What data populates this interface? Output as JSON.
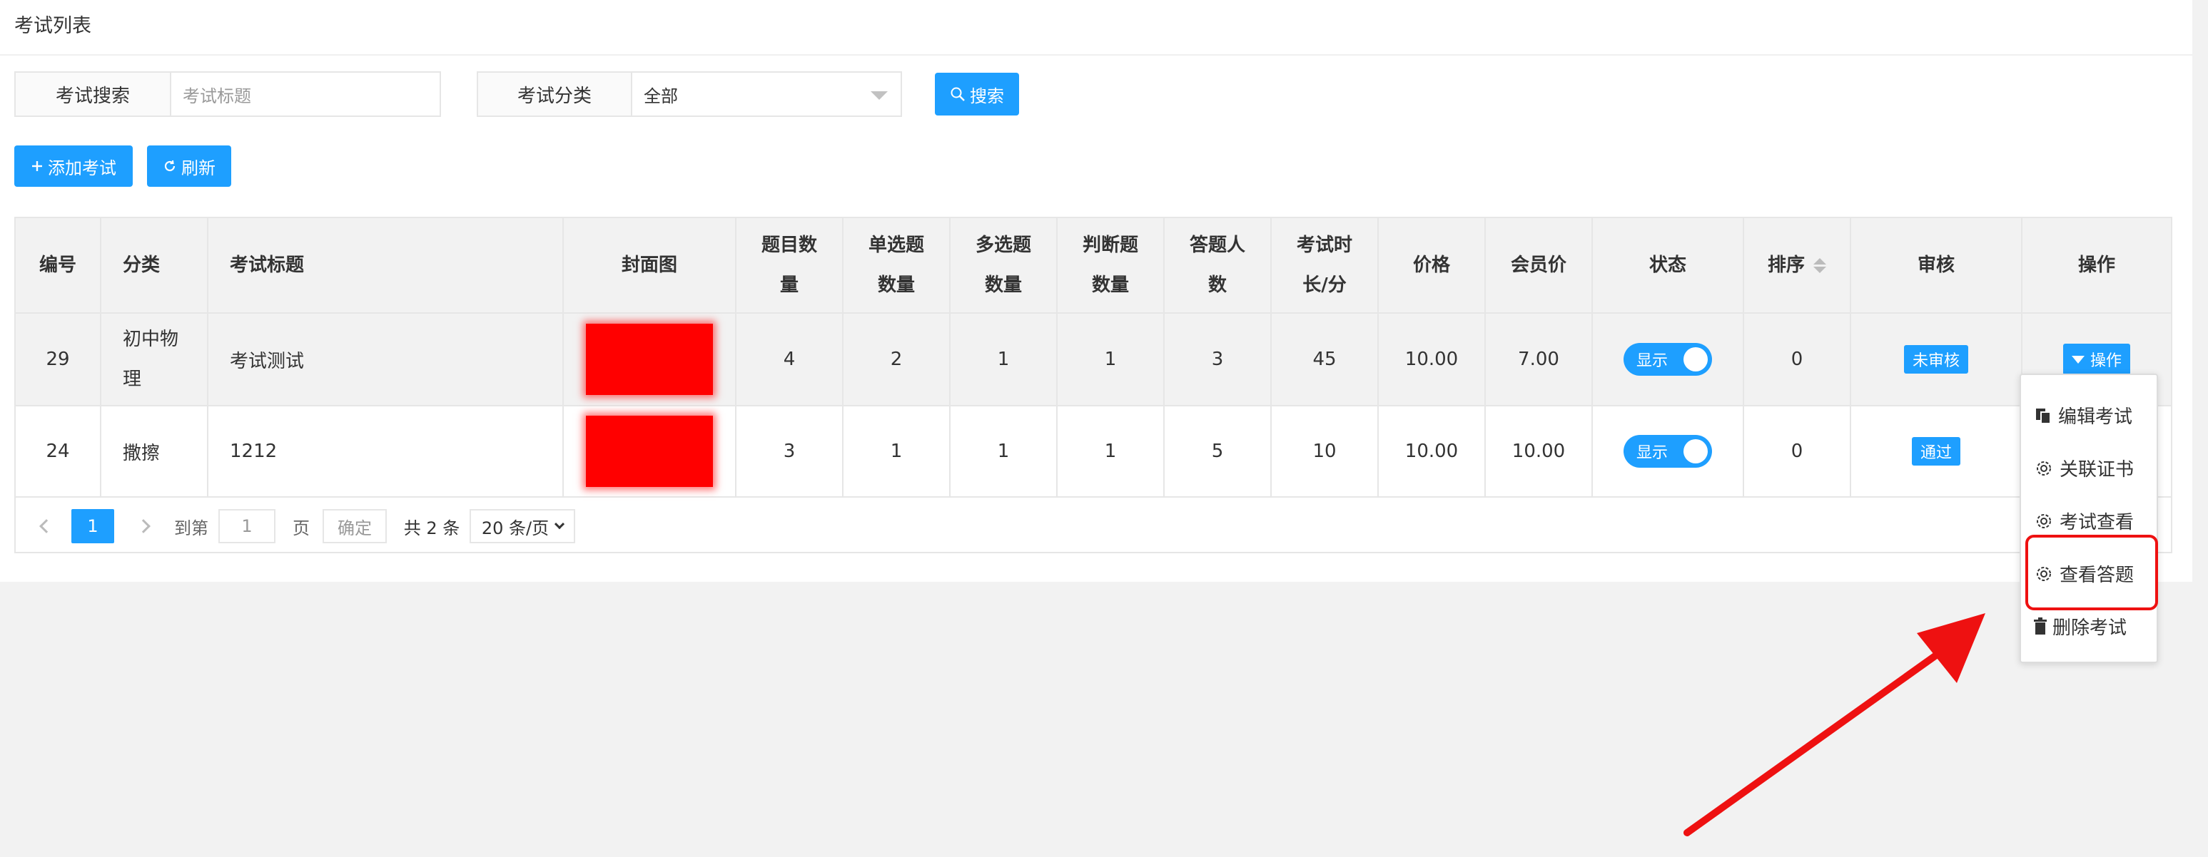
{
  "page": {
    "title": "考试列表"
  },
  "search": {
    "title_label": "考试搜索",
    "title_placeholder": "考试标题",
    "category_label": "考试分类",
    "category_value": "全部",
    "search_button": "搜索"
  },
  "toolbar": {
    "add_label": "添加考试",
    "refresh_label": "刷新"
  },
  "table": {
    "headers": {
      "id": "编号",
      "category": "分类",
      "title": "考试标题",
      "cover": "封面图",
      "question_count": [
        "题目数",
        "量"
      ],
      "single_choice": [
        "单选题",
        "数量"
      ],
      "multi_choice": [
        "多选题",
        "数量"
      ],
      "true_false": [
        "判断题",
        "数量"
      ],
      "answer_count": [
        "答题人",
        "数"
      ],
      "duration": [
        "考试时",
        "长/分"
      ],
      "price": "价格",
      "member_price": "会员价",
      "status": "状态",
      "sort": "排序",
      "review": "审核",
      "actions": "操作"
    },
    "rows": [
      {
        "id": "29",
        "category": [
          "初中物",
          "理"
        ],
        "title": "考试测试",
        "question_count": "4",
        "single_choice": "2",
        "multi_choice": "1",
        "true_false": "1",
        "answer_count": "3",
        "duration": "45",
        "price": "10.00",
        "member_price": "7.00",
        "status": "显示",
        "sort": "0",
        "review": "未审核",
        "action": "操作"
      },
      {
        "id": "24",
        "category": [
          "撒擦"
        ],
        "title": "1212",
        "question_count": "3",
        "single_choice": "1",
        "multi_choice": "1",
        "true_false": "1",
        "answer_count": "5",
        "duration": "10",
        "price": "10.00",
        "member_price": "10.00",
        "status": "显示",
        "sort": "0",
        "review": "通过"
      }
    ]
  },
  "pagination": {
    "current": "1",
    "goto_label": "到第",
    "goto_value": "1",
    "page_unit": "页",
    "confirm": "确定",
    "total": "共 2 条",
    "page_size": "20 条/页"
  },
  "action_menu": {
    "items": [
      "编辑考试",
      "关联证书",
      "考试查看",
      "查看答题",
      "删除考试"
    ]
  },
  "colors": {
    "primary": "#1e9fff",
    "highlight": "#ee1111",
    "cover_redaction": "#ff0000"
  }
}
